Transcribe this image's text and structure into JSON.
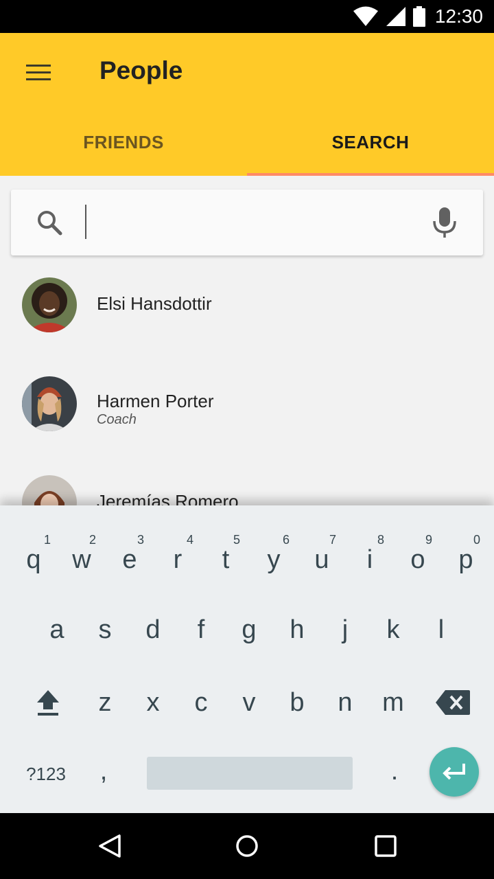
{
  "status_bar": {
    "time": "12:30",
    "icons": [
      "wifi-icon",
      "signal-icon",
      "battery-icon"
    ]
  },
  "app_bar": {
    "title": "People",
    "menu_icon": "menu-icon",
    "background_color": "#ffca28"
  },
  "tabs": [
    {
      "label": "FRIENDS",
      "selected": false
    },
    {
      "label": "SEARCH",
      "selected": true
    }
  ],
  "tab_indicator_color": "#ff8a65",
  "search": {
    "value": "",
    "placeholder": "",
    "left_icon": "search-icon",
    "right_icon": "mic-icon"
  },
  "people": [
    {
      "name": "Elsi Hansdottir",
      "role": ""
    },
    {
      "name": "Harmen Porter",
      "role": "Coach"
    },
    {
      "name": "Jeremías Romero",
      "role": ""
    }
  ],
  "keyboard": {
    "row1": [
      "q",
      "w",
      "e",
      "r",
      "t",
      "y",
      "u",
      "i",
      "o",
      "p"
    ],
    "row1_hints": [
      "1",
      "2",
      "3",
      "4",
      "5",
      "6",
      "7",
      "8",
      "9",
      "0"
    ],
    "row2": [
      "a",
      "s",
      "d",
      "f",
      "g",
      "h",
      "j",
      "k",
      "l"
    ],
    "row3": [
      "z",
      "x",
      "c",
      "v",
      "b",
      "n",
      "m"
    ],
    "symbols_label": "?123",
    "comma_label": ",",
    "period_label": ".",
    "shift_icon": "shift-icon",
    "backspace_icon": "backspace-icon",
    "enter_icon": "enter-icon",
    "enter_color": "#4db6ac"
  },
  "nav_bar": {
    "icons": [
      "back-icon",
      "home-icon",
      "recents-icon"
    ]
  }
}
